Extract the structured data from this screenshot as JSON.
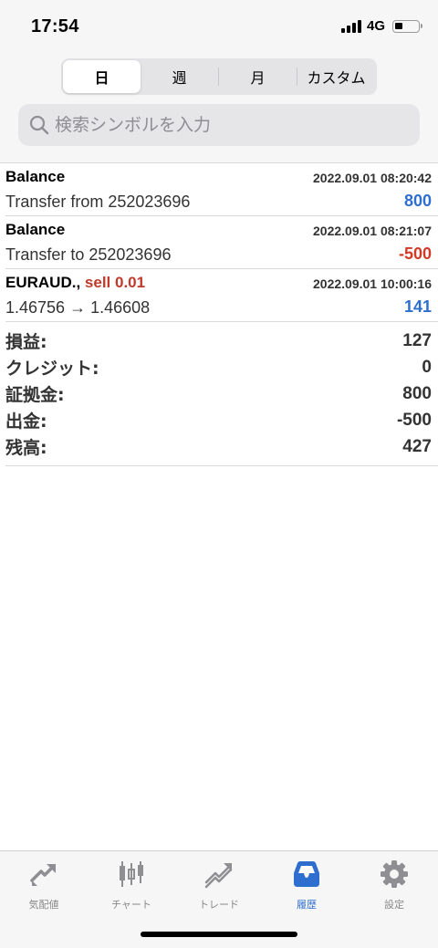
{
  "status": {
    "time": "17:54",
    "network": "4G"
  },
  "periods": [
    "日",
    "週",
    "月",
    "カスタム"
  ],
  "search": {
    "placeholder": "検索シンボルを入力"
  },
  "entries": [
    {
      "title": "Balance",
      "deal": "",
      "time": "2022.09.01 08:20:42",
      "desc": "Transfer from 252023696",
      "amount": "800"
    },
    {
      "title": "Balance",
      "deal": "",
      "time": "2022.09.01 08:21:07",
      "desc": "Transfer to 252023696",
      "amount": "-500"
    },
    {
      "title": "EURAUD.,",
      "deal": "sell 0.01",
      "time": "2022.09.01 10:00:16",
      "desc": "1.46756 → 1.46608",
      "amount": "141"
    }
  ],
  "summary": [
    {
      "label": "損益:",
      "value": "127"
    },
    {
      "label": "クレジット:",
      "value": "0"
    },
    {
      "label": "証拠金:",
      "value": "800"
    },
    {
      "label": "出金:",
      "value": "-500"
    },
    {
      "label": "残高:",
      "value": "427"
    }
  ],
  "tabs": [
    {
      "label": "気配値",
      "icon": "quotes-icon"
    },
    {
      "label": "チャート",
      "icon": "chart-icon"
    },
    {
      "label": "トレード",
      "icon": "trade-icon"
    },
    {
      "label": "履歴",
      "icon": "history-icon"
    },
    {
      "label": "設定",
      "icon": "settings-icon"
    }
  ],
  "colors": {
    "accent": "#2d6ecf",
    "negative": "#d13a26",
    "inactive_icon": "#8e8e93"
  }
}
